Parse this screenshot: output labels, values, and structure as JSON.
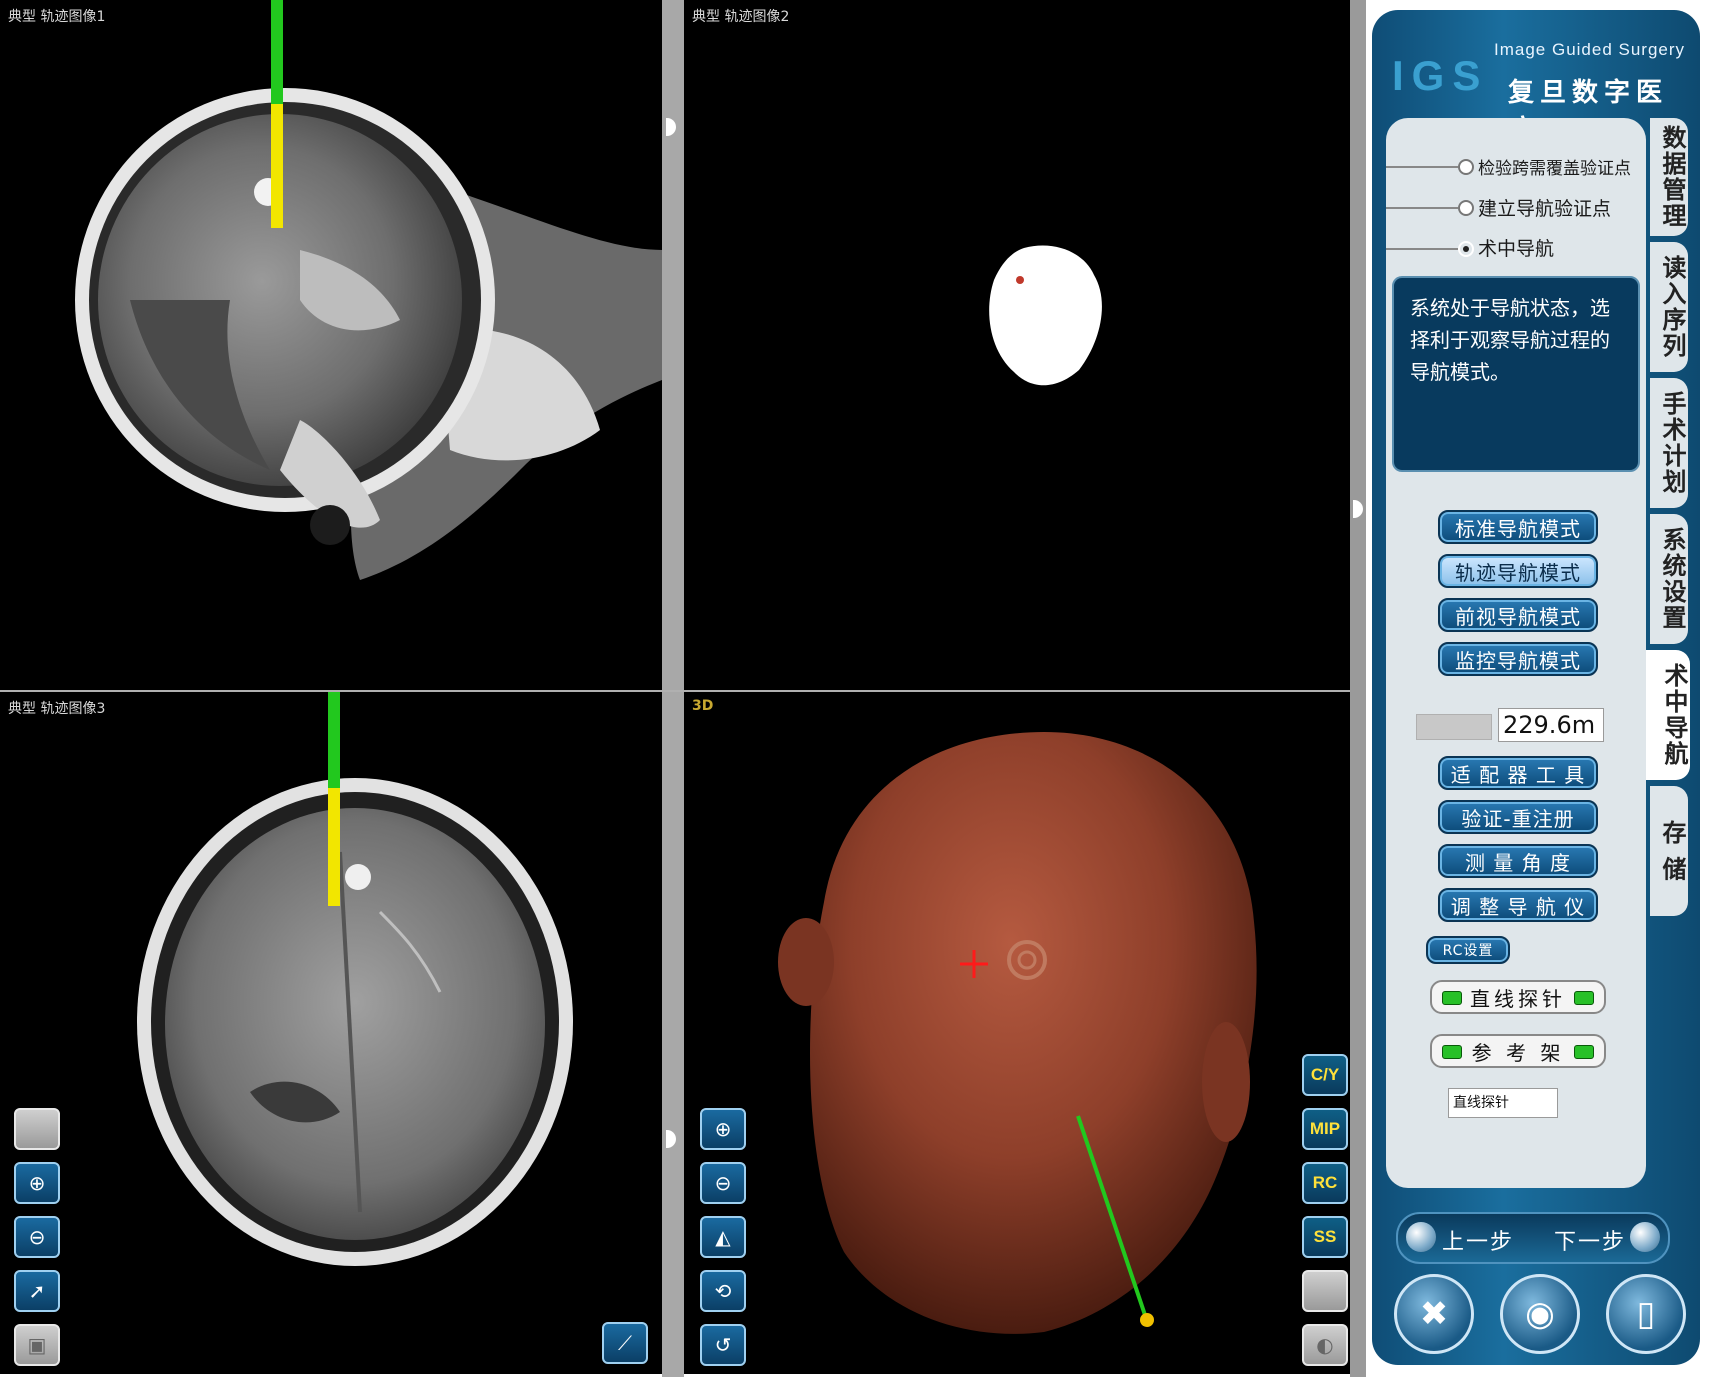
{
  "viewports": {
    "tl_title": "典型 轨迹图像1",
    "tr_title": "典型 轨迹图像2",
    "bl_title": "典型 轨迹图像3",
    "br_title": "3D"
  },
  "left_tools": [
    {
      "icon": "blank-icon"
    },
    {
      "icon": "zoom-in-icon"
    },
    {
      "icon": "zoom-out-icon"
    },
    {
      "icon": "pointer-icon"
    },
    {
      "icon": "cube-icon"
    }
  ],
  "tools_3d_left": [
    {
      "icon": "zoom-in-icon"
    },
    {
      "icon": "zoom-out-icon"
    },
    {
      "icon": "pan-icon"
    },
    {
      "icon": "rotate-icon"
    },
    {
      "icon": "reset-view-icon"
    }
  ],
  "tools_3d_right": [
    "C/Y",
    "MIP",
    "RC",
    "SS",
    "",
    ""
  ],
  "panel": {
    "brand_en": "Image Guided Surgery",
    "brand_logo": "IGS",
    "brand_cn": "复旦数字医疗",
    "radios": [
      {
        "label": "检验跨需覆盖验证点",
        "selected": false
      },
      {
        "label": "建立导航验证点",
        "selected": false
      },
      {
        "label": "术中导航",
        "selected": true
      }
    ],
    "message": "系统处于导航状态，选择利于观察导航过程的导航模式。",
    "mode_buttons": [
      "标准导航模式",
      "轨迹导航模式",
      "前视导航模式",
      "监控导航模式"
    ],
    "active_mode": 1,
    "depth_value": "229.6m",
    "tool_buttons": [
      "适 配 器 工 具",
      "验证-重注册",
      "测 量 角 度",
      "调 整 导 航 仪"
    ],
    "rc_button": "RC设置",
    "toggles": [
      "直线探针",
      "参 考 架"
    ],
    "probe_field": "直线探针",
    "tabs": [
      "数据管理",
      "读入序列",
      "手术计划",
      "系统设置",
      "术中导航",
      "存 储"
    ],
    "active_tab": 4,
    "prev_label": "上一步",
    "next_label": "下一步",
    "bottom_icons": [
      "tools-icon",
      "camera-icon",
      "exit-door-icon"
    ]
  },
  "colors": {
    "trajectory_green": "#22c81e",
    "trajectory_yellow": "#f2e600",
    "head_surface": "#8e3f2a",
    "panel_blue": "#1a6e9e"
  }
}
